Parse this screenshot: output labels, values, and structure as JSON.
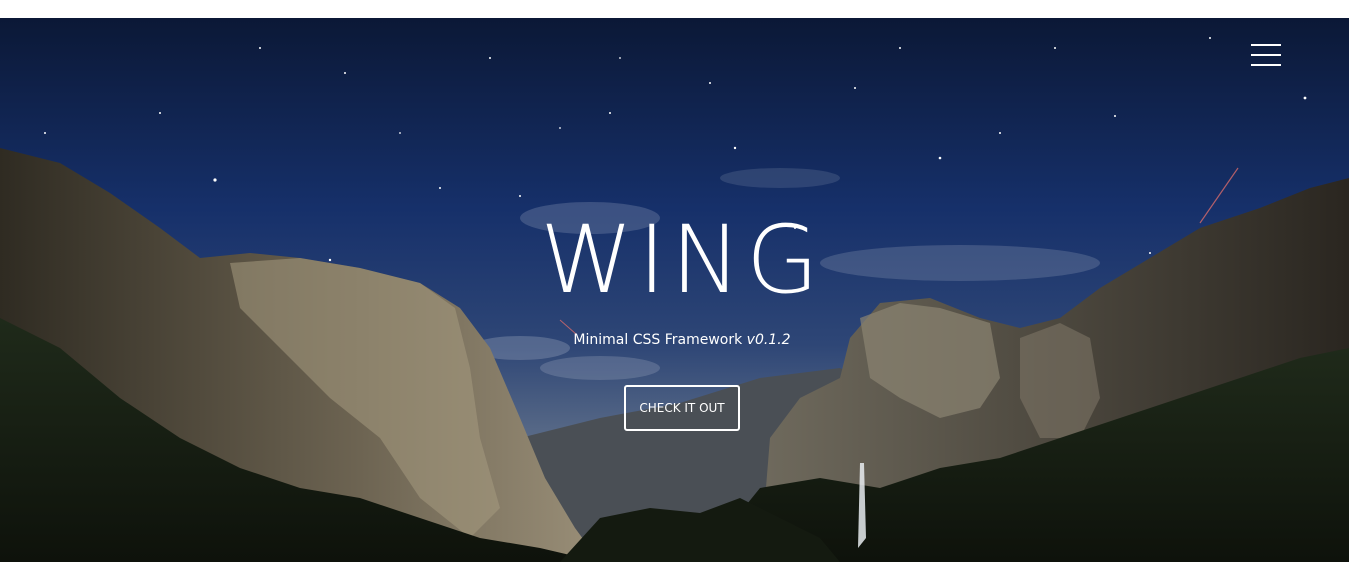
{
  "hero": {
    "title": "WING",
    "subtitle_text": "Minimal CSS Framework",
    "version": "v0.1.2",
    "cta_label": "CHECK IT OUT",
    "background": "starry night sky over Yosemite valley with cliffs and a waterfall"
  },
  "nav": {
    "menu_icon": "hamburger-menu-icon"
  },
  "colors": {
    "text": "#ffffff",
    "sky_top": "#0d1a3a",
    "sky_mid": "#1d3670",
    "page_background": "#ffffff"
  }
}
